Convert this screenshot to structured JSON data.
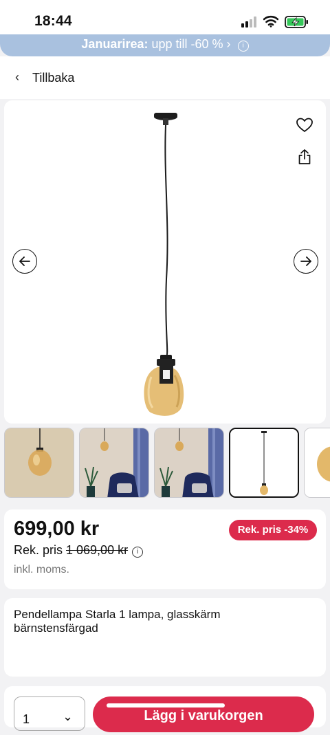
{
  "status_bar": {
    "time": "18:44"
  },
  "promo": {
    "bold": "Januarirea:",
    "text": "upp till -60 % ›"
  },
  "nav": {
    "back_label": "Tillbaka"
  },
  "product": {
    "price": "699,00 kr",
    "badge": "Rek. pris -34%",
    "rek_label": "Rek. pris",
    "rek_old_price": "1 069,00 kr",
    "vat_note": "inkl. moms.",
    "title": "Pendellampa Starla 1 lampa, glasskärm bärnstensfärgad"
  },
  "purchase": {
    "quantity": "1",
    "add_to_cart_label": "Lägg i varukorgen"
  },
  "icons": {
    "back": "chevron-left-icon",
    "favorite": "heart-icon",
    "share": "share-icon",
    "prev": "arrow-left-icon",
    "next": "arrow-right-icon"
  },
  "colors": {
    "accent": "#dc2b4c",
    "promo_bg": "#a9c1df",
    "amber_glass": "#e3b86a"
  }
}
